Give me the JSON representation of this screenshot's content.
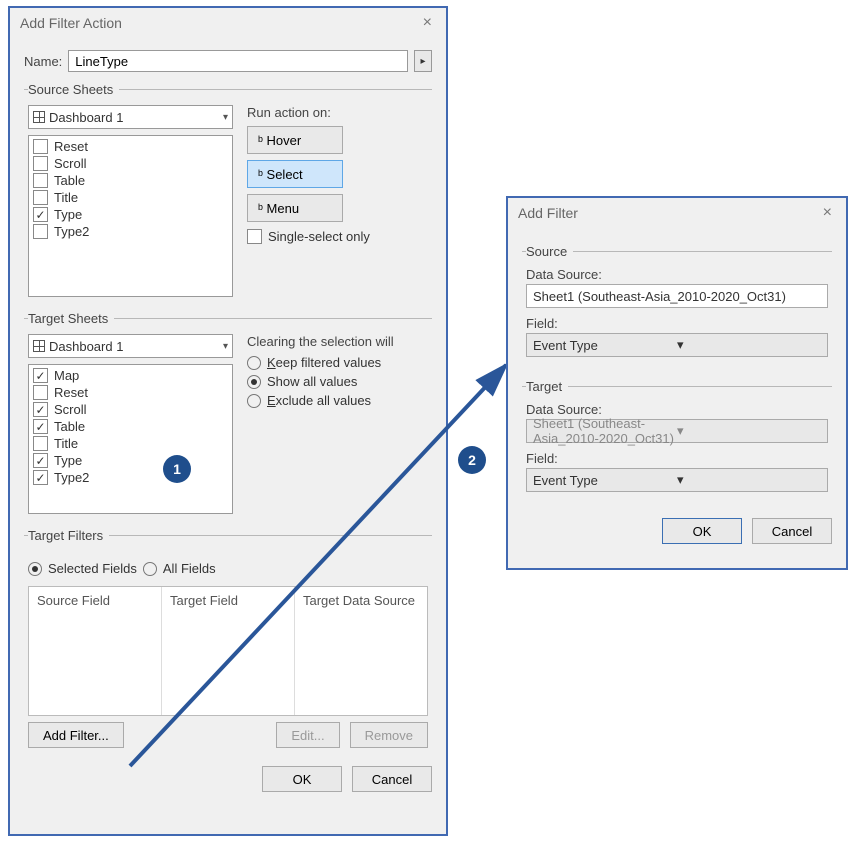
{
  "main_dialog": {
    "title": "Add Filter Action",
    "name_label": "Name:",
    "name_value": "LineType",
    "source_sheets": {
      "legend": "Source Sheets",
      "combo": "Dashboard 1",
      "items": [
        {
          "label": "Reset",
          "checked": false
        },
        {
          "label": "Scroll",
          "checked": false
        },
        {
          "label": "Table",
          "checked": false
        },
        {
          "label": "Title",
          "checked": false
        },
        {
          "label": "Type",
          "checked": true
        },
        {
          "label": "Type2",
          "checked": false
        }
      ],
      "run_label": "Run action on:",
      "run_buttons": {
        "hover": "Hover",
        "select": "Select",
        "menu": "Menu"
      },
      "single_select": "Single-select only"
    },
    "target_sheets": {
      "legend": "Target Sheets",
      "combo": "Dashboard 1",
      "items": [
        {
          "label": "Map",
          "checked": true
        },
        {
          "label": "Reset",
          "checked": false
        },
        {
          "label": "Scroll",
          "checked": true
        },
        {
          "label": "Table",
          "checked": true
        },
        {
          "label": "Title",
          "checked": false
        },
        {
          "label": "Type",
          "checked": true
        },
        {
          "label": "Type2",
          "checked": true
        }
      ],
      "clearing_label": "Clearing the selection will",
      "clearing_options": {
        "keep": "Keep filtered values",
        "show": "Show all values",
        "exclude": "Exclude all values"
      }
    },
    "target_filters": {
      "legend": "Target Filters",
      "selected_fields": "Selected Fields",
      "all_fields": "All Fields",
      "cols": {
        "source_field": "Source Field",
        "target_field": "Target Field",
        "target_ds": "Target Data Source"
      },
      "add_filter_btn": "Add Filter...",
      "edit_btn": "Edit...",
      "remove_btn": "Remove"
    },
    "ok": "OK",
    "cancel": "Cancel"
  },
  "sub_dialog": {
    "title": "Add Filter",
    "source": {
      "legend": "Source",
      "ds_label": "Data Source:",
      "ds_value": "Sheet1 (Southeast-Asia_2010-2020_Oct31)",
      "field_label": "Field:",
      "field_value": "Event Type"
    },
    "target": {
      "legend": "Target",
      "ds_label": "Data Source:",
      "ds_value": "Sheet1 (Southeast-Asia_2010-2020_Oct31)",
      "field_label": "Field:",
      "field_value": "Event Type"
    },
    "ok": "OK",
    "cancel": "Cancel"
  },
  "callouts": {
    "one": "1",
    "two": "2"
  }
}
